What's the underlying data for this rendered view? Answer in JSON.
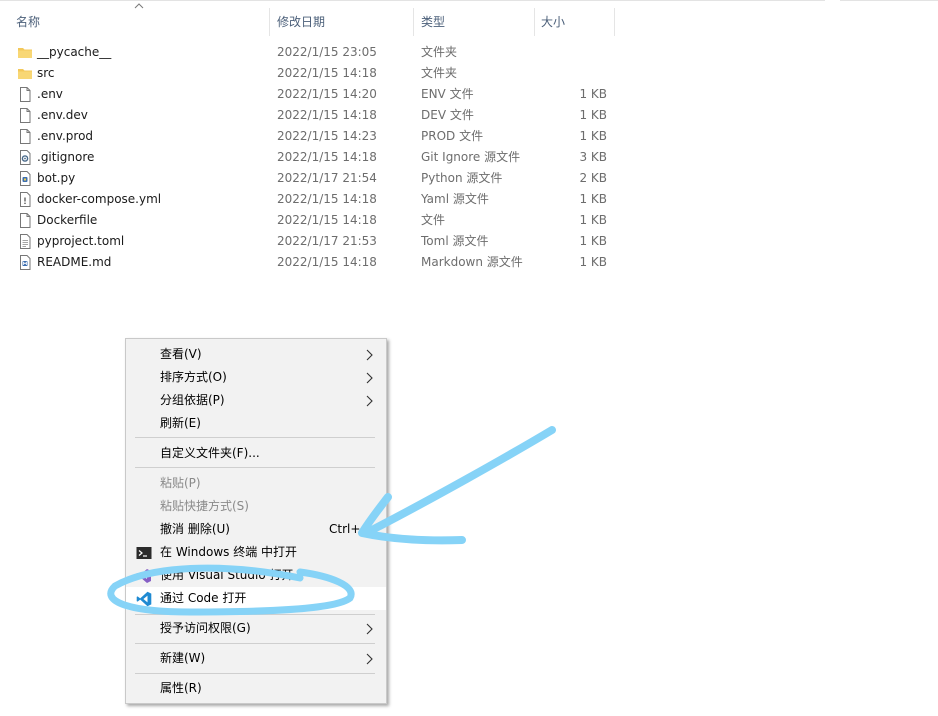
{
  "header": {
    "name": "名称",
    "date": "修改日期",
    "type": "类型",
    "size": "大小"
  },
  "files": [
    {
      "icon": "folder-icon",
      "name": "__pycache__",
      "date": "2022/1/15 23:05",
      "type": "文件夹",
      "size": ""
    },
    {
      "icon": "folder-icon",
      "name": "src",
      "date": "2022/1/15 14:18",
      "type": "文件夹",
      "size": ""
    },
    {
      "icon": "file-icon",
      "name": ".env",
      "date": "2022/1/15 14:20",
      "type": "ENV 文件",
      "size": "1 KB"
    },
    {
      "icon": "file-icon",
      "name": ".env.dev",
      "date": "2022/1/15 14:18",
      "type": "DEV 文件",
      "size": "1 KB"
    },
    {
      "icon": "file-icon",
      "name": ".env.prod",
      "date": "2022/1/15 14:23",
      "type": "PROD 文件",
      "size": "1 KB"
    },
    {
      "icon": "gear-file-icon",
      "name": ".gitignore",
      "date": "2022/1/15 14:18",
      "type": "Git Ignore 源文件",
      "size": "3 KB"
    },
    {
      "icon": "python-file-icon",
      "name": "bot.py",
      "date": "2022/1/17 21:54",
      "type": "Python 源文件",
      "size": "2 KB"
    },
    {
      "icon": "yaml-file-icon",
      "name": "docker-compose.yml",
      "date": "2022/1/15 14:18",
      "type": "Yaml 源文件",
      "size": "1 KB"
    },
    {
      "icon": "file-icon",
      "name": "Dockerfile",
      "date": "2022/1/15 14:18",
      "type": "文件",
      "size": "1 KB"
    },
    {
      "icon": "text-file-icon",
      "name": "pyproject.toml",
      "date": "2022/1/17 21:53",
      "type": "Toml 源文件",
      "size": "1 KB"
    },
    {
      "icon": "markdown-file-icon",
      "name": "README.md",
      "date": "2022/1/15 14:18",
      "type": "Markdown 源文件",
      "size": "1 KB"
    }
  ],
  "context_menu": {
    "view": "查看(V)",
    "sort": "排序方式(O)",
    "group": "分组依据(P)",
    "refresh": "刷新(E)",
    "customize": "自定义文件夹(F)...",
    "paste": "粘贴(P)",
    "paste_shortcut": "粘贴快捷方式(S)",
    "undo_delete": "撤消 删除(U)",
    "undo_shortcut": "Ctrl+",
    "open_terminal": "在 Windows 终端 中打开",
    "open_vs": "使用 Visual Studio 打开",
    "open_code": "通过 Code 打开",
    "grant_access": "授予访问权限(G)",
    "new": "新建(W)",
    "properties": "属性(R)"
  },
  "colors": {
    "annotation": "#86d3f7",
    "folder": "#f3c85a",
    "vscode": "#1f8ad2",
    "vs": "#865fc5",
    "header_text": "#4c607a"
  }
}
